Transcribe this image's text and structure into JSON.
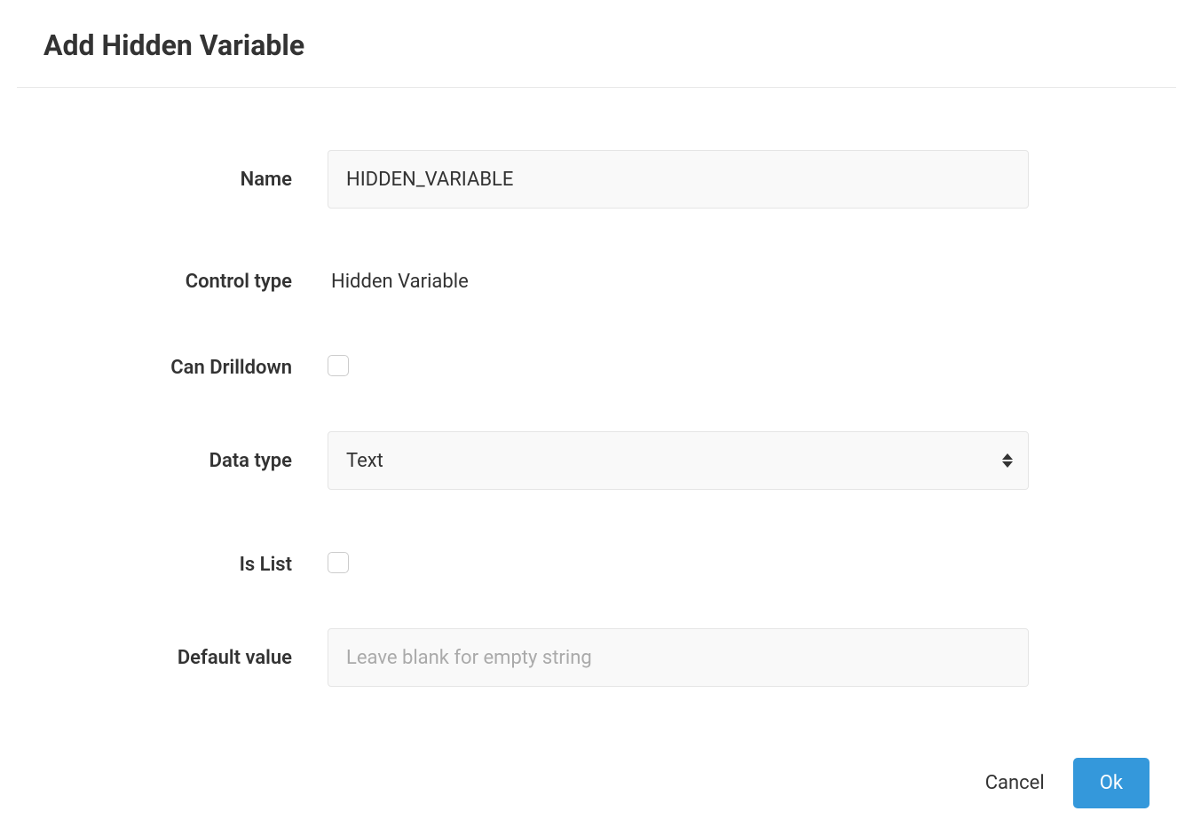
{
  "dialog": {
    "title": "Add Hidden Variable",
    "fields": {
      "name": {
        "label": "Name",
        "value": "HIDDEN_VARIABLE"
      },
      "control_type": {
        "label": "Control type",
        "value": "Hidden Variable"
      },
      "can_drilldown": {
        "label": "Can Drilldown",
        "checked": false
      },
      "data_type": {
        "label": "Data type",
        "value": "Text"
      },
      "is_list": {
        "label": "Is List",
        "checked": false
      },
      "default_value": {
        "label": "Default value",
        "value": "",
        "placeholder": "Leave blank for empty string"
      }
    },
    "buttons": {
      "cancel": "Cancel",
      "ok": "Ok"
    }
  }
}
